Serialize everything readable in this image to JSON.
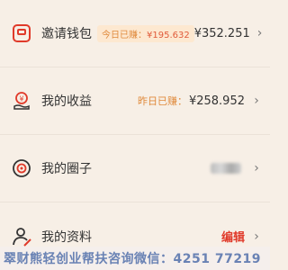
{
  "menu": {
    "invite": {
      "label": "邀请钱包",
      "badge_prefix": "今日已赚：",
      "badge_amount": "¥195.632",
      "value": "¥352.251",
      "icon": "wallet-icon"
    },
    "earnings": {
      "label": "我的收益",
      "hint_prefix": "昨日已赚：",
      "value": "¥258.952",
      "icon": "yuan-hand-icon"
    },
    "circle": {
      "label": "我的圈子",
      "icon": "circle-target-icon"
    },
    "profile": {
      "label": "我的资料",
      "action": "编辑",
      "icon": "profile-edit-icon"
    }
  },
  "chevron": "›",
  "watermark": "翠财熊轻创业帮扶咨询微信：4251 77219",
  "colors": {
    "accent": "#e03a2a",
    "badge_bg": "#fde8d0",
    "background": "#f7efe6"
  }
}
